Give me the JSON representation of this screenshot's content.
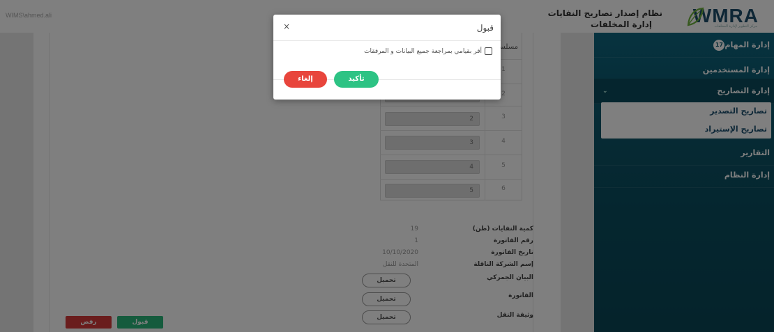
{
  "header": {
    "user": "WIMS\\ahmed.ali",
    "logo_text": "WMRA",
    "logo_sub": "مركز التطوير لإدارة المخلفات",
    "system_title": "نظام إصدار تصاريح النفايات",
    "system_subtitle": "إدارة المخلفات"
  },
  "sidebar": {
    "items": [
      {
        "label": "إدارة المهام",
        "badge": "17"
      },
      {
        "label": "إدارة المستخدمين"
      },
      {
        "label": "إدارة التصاريح"
      },
      {
        "label": "التقارير"
      },
      {
        "label": "إدارة النظام"
      }
    ],
    "submenu": [
      {
        "label": "تصاريح التصدير"
      },
      {
        "label": "تصاريح الإستيراد"
      }
    ]
  },
  "table": {
    "header": "مسلسل",
    "rows": [
      {
        "num": "1",
        "value": ""
      },
      {
        "num": "2",
        "value": ""
      },
      {
        "num": "3",
        "value": "2"
      },
      {
        "num": "4",
        "value": "3"
      },
      {
        "num": "5",
        "value": "4"
      },
      {
        "num": "6",
        "value": "5"
      }
    ]
  },
  "details": [
    {
      "label": "كمية النفايات (طن)",
      "value": "19"
    },
    {
      "label": "رقم الفاتورة",
      "value": "1"
    },
    {
      "label": "تاريخ الفاتورة",
      "value": "10/10/2020"
    },
    {
      "label": "إسم الشركة الناقلة",
      "value": "المتحدة للنقل"
    },
    {
      "label": "البيان الجمركي",
      "value": ""
    },
    {
      "label": "الفاتورة",
      "value": ""
    },
    {
      "label": "وثيقة النقل",
      "value": ""
    }
  ],
  "download_label": "تحميل",
  "footer": {
    "accept": "قبول",
    "reject": "رفض"
  },
  "modal": {
    "title": "قبول",
    "close": "×",
    "checkbox_label": "أقر بقيامي بمراجعة جميع البيانات و المرفقات",
    "confirm": "تأكيد",
    "cancel": "إلغاء"
  }
}
